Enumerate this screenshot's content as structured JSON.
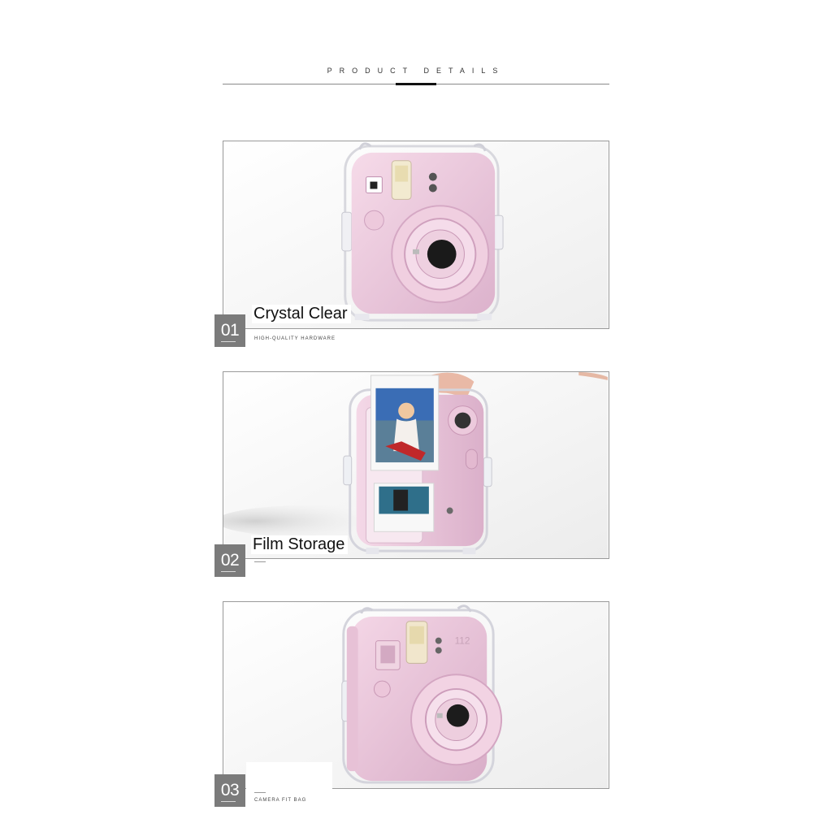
{
  "header": {
    "title": "PRODUCT  DETAILS"
  },
  "items": [
    {
      "number": "01",
      "title": "Crystal Clear",
      "subtitle": "HIGH-QUALITY HARDWARE"
    },
    {
      "number": "02",
      "title": "Film Storage",
      "subtitle": ""
    },
    {
      "number": "03",
      "title": "",
      "subtitle": "CAMERA FIT BAG"
    }
  ],
  "camera_model": "112",
  "colors": {
    "camera_pink": "#e9c6dc",
    "case_outline": "#d4d4dc",
    "badge_gray": "#7b7b7b"
  }
}
